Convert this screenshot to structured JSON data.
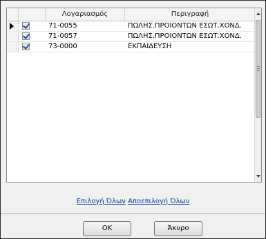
{
  "grid": {
    "columns": [
      "Λογαριασμός",
      "Περιγραφή"
    ],
    "rows": [
      {
        "account": "71-0055",
        "description": "ΠΩΛΗΣ.ΠΡΟΙΟΝΤΩΝ ΕΣΩΤ.ΧΟΝΔ.",
        "checked": true,
        "current": true
      },
      {
        "account": "71-0057",
        "description": "ΠΩΛΗΣ.ΠΡΟΙΟΝΤΩΝ ΕΣΩΤ.ΧΟΝΔ.",
        "checked": true,
        "current": false
      },
      {
        "account": "73-0000",
        "description": "ΕΚΠΑΙΔΕΥΣΗ",
        "checked": true,
        "current": false
      }
    ]
  },
  "links": {
    "select_all": "Επιλογή Όλων",
    "deselect_all": "Αποεπιλογή Όλων"
  },
  "buttons": {
    "ok": "OK",
    "cancel": "Άκυρο"
  },
  "icons": {
    "row_indicator": "current-row-arrow-icon",
    "checkbox": "checkbox-checked-icon"
  }
}
